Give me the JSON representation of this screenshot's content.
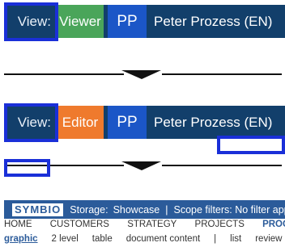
{
  "top_bar": {
    "view_label": "View:",
    "mode": "Viewer",
    "mode_color": "#4aa55a",
    "initials": "PP",
    "user_name": "Peter Prozess (EN)"
  },
  "bottom_bar": {
    "view_label": "View:",
    "mode": "Editor",
    "mode_color": "#ef7a2d",
    "initials": "PP",
    "user_name": "Peter Prozess (EN)"
  },
  "symbio": {
    "logo": "SYMBIO",
    "storage_label": "Storage:",
    "storage_value": "Showcase",
    "separator": "|",
    "scope": "Scope filters: No filter applied"
  },
  "nav": {
    "items": [
      "HOME",
      "CUSTOMERS",
      "STRATEGY",
      "PROJECTS",
      "PROCESSES"
    ],
    "active": "PROCESSES"
  },
  "subnav": {
    "items": [
      "graphic",
      "2 level",
      "table",
      "document content",
      "|",
      "list",
      "review"
    ],
    "active": "graphic"
  },
  "colors": {
    "bar_bg": "#123f6b",
    "highlight": "#1a2fd8",
    "initials_bg": "#1b56c7"
  }
}
